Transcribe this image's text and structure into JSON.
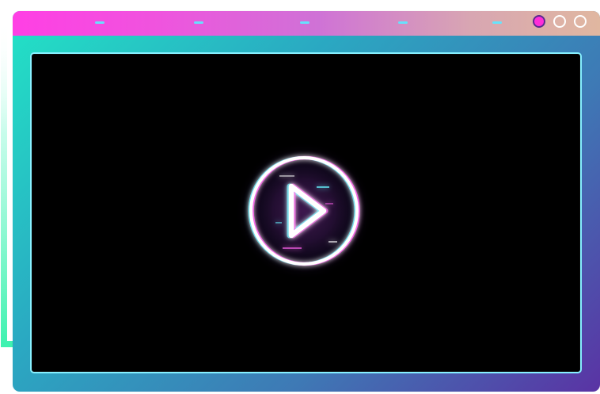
{
  "window": {
    "titlebar_gradient_colors": [
      "#ff3fe4",
      "#ef54de",
      "#cf72d6",
      "#d8a6b2",
      "#e0b7a0"
    ],
    "body_gradient_colors": [
      "#22e3c6",
      "#2aa9c2",
      "#3e79b5",
      "#5a33a4"
    ],
    "viewport_background": "#000000",
    "viewport_border": "#86f0ff",
    "controls": [
      {
        "icon": "circle-control-icon",
        "active": true
      },
      {
        "icon": "circle-control-icon",
        "active": false
      },
      {
        "icon": "circle-control-icon",
        "active": false
      }
    ]
  },
  "player": {
    "play_icon": "play-icon",
    "play_icon_colors": {
      "outline": "#ffffff",
      "glow": "#ff63ef",
      "glitch_cyan": "#66f3ff",
      "inner": "#36154d"
    }
  },
  "decorations": {
    "left_accent_line_color": "#3ff2b0",
    "titlebar_dash_color": "#61e6ff"
  }
}
